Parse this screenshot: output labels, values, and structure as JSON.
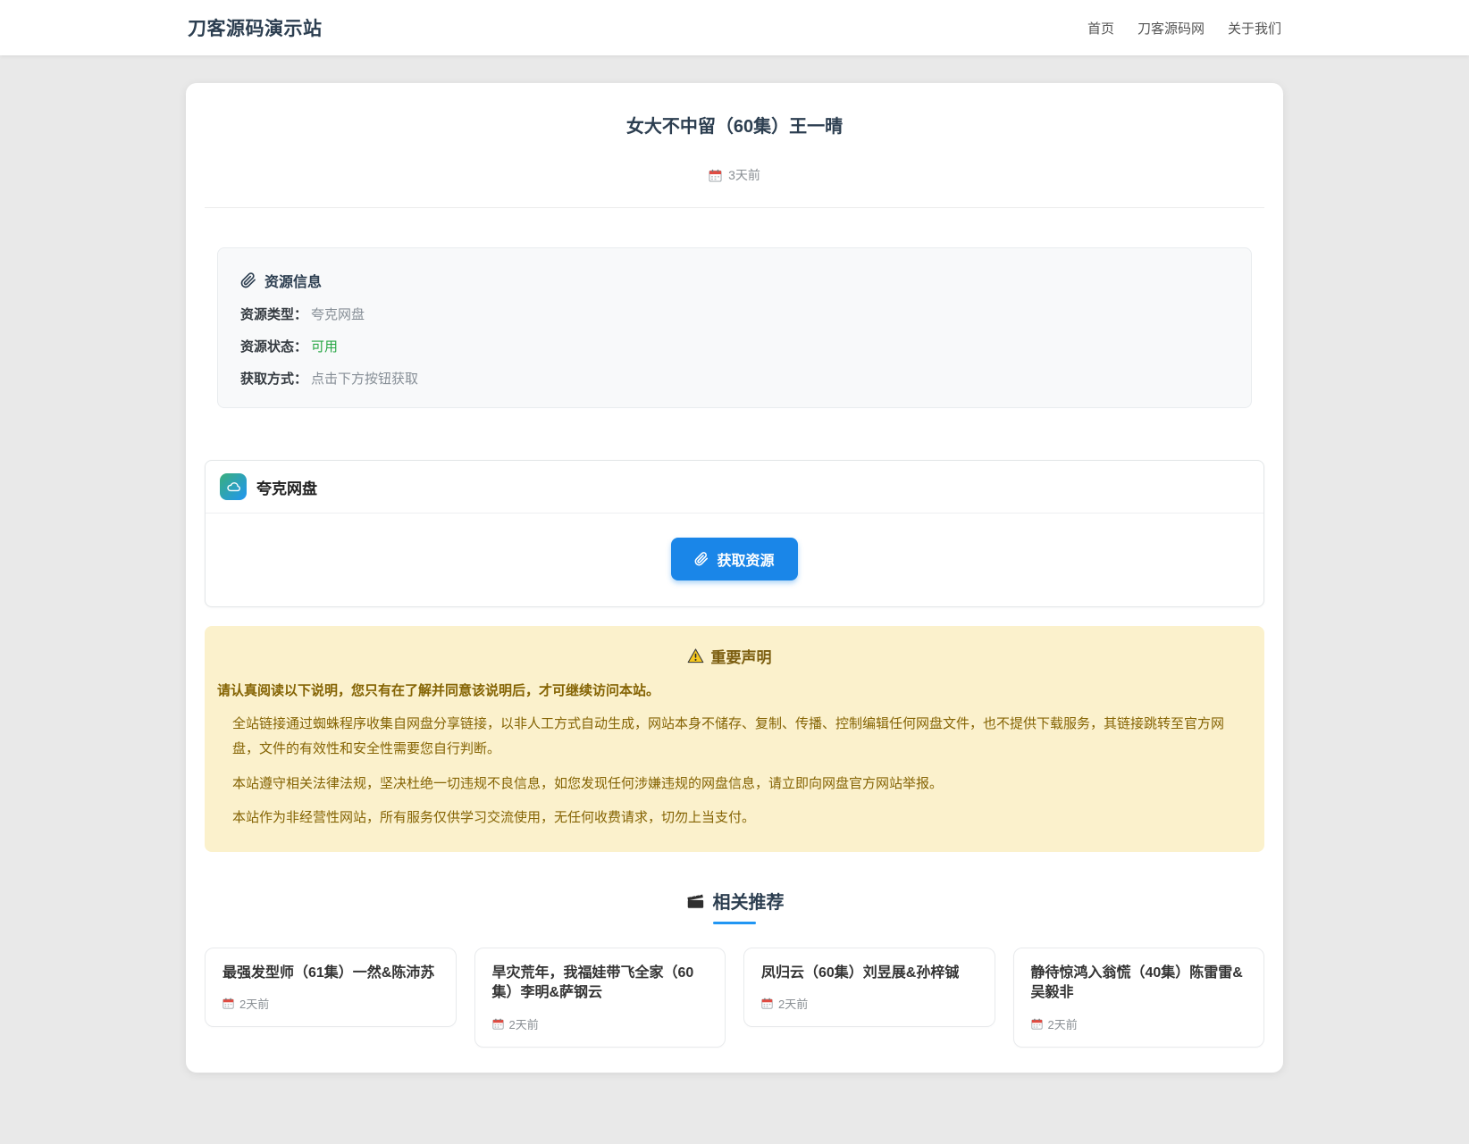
{
  "header": {
    "title": "刀客源码演示站",
    "nav": [
      {
        "label": "首页"
      },
      {
        "label": "刀客源码网"
      },
      {
        "label": "关于我们"
      }
    ]
  },
  "article": {
    "title": "女大不中留（60集）王一晴",
    "date": "3天前"
  },
  "resource_info": {
    "title": "资源信息",
    "rows": [
      {
        "label": "资源类型：",
        "value": "夸克网盘",
        "status": "muted"
      },
      {
        "label": "资源状态：",
        "value": "可用",
        "status": "success"
      },
      {
        "label": "获取方式：",
        "value": "点击下方按钮获取",
        "status": "muted"
      }
    ]
  },
  "download": {
    "provider": "夸克网盘",
    "button_label": "获取资源"
  },
  "notice": {
    "title": "重要声明",
    "lead": "请认真阅读以下说明，您只有在了解并同意该说明后，才可继续访问本站。",
    "paragraphs": [
      "全站链接通过蜘蛛程序收集自网盘分享链接，以非人工方式自动生成，网站本身不储存、复制、传播、控制编辑任何网盘文件，也不提供下载服务，其链接跳转至官方网盘，文件的有效性和安全性需要您自行判断。",
      "本站遵守相关法律法规，坚决杜绝一切违规不良信息，如您发现任何涉嫌违规的网盘信息，请立即向网盘官方网站举报。",
      "本站作为非经营性网站，所有服务仅供学习交流使用，无任何收费请求，切勿上当支付。"
    ]
  },
  "related": {
    "title": "相关推荐",
    "items": [
      {
        "title": "最强发型师（61集）一然&陈沛苏",
        "date": "2天前"
      },
      {
        "title": "旱灾荒年，我福娃带飞全家（60集）李明&萨钢云",
        "date": "2天前"
      },
      {
        "title": "凤归云（60集）刘昱展&孙梓铖",
        "date": "2天前"
      },
      {
        "title": "静待惊鸿入翁慌（40集）陈雷雷&吴毅非",
        "date": "2天前"
      }
    ]
  },
  "colors": {
    "accent_blue": "#1a86e8",
    "success_green": "#28a745",
    "notice_bg": "#fbf1cc",
    "notice_text": "#856404",
    "brand_text": "#2c3e50",
    "underline_blue": "#2196f3",
    "provider_gradient_start": "#3aaf7c",
    "provider_gradient_end": "#2196f3"
  }
}
